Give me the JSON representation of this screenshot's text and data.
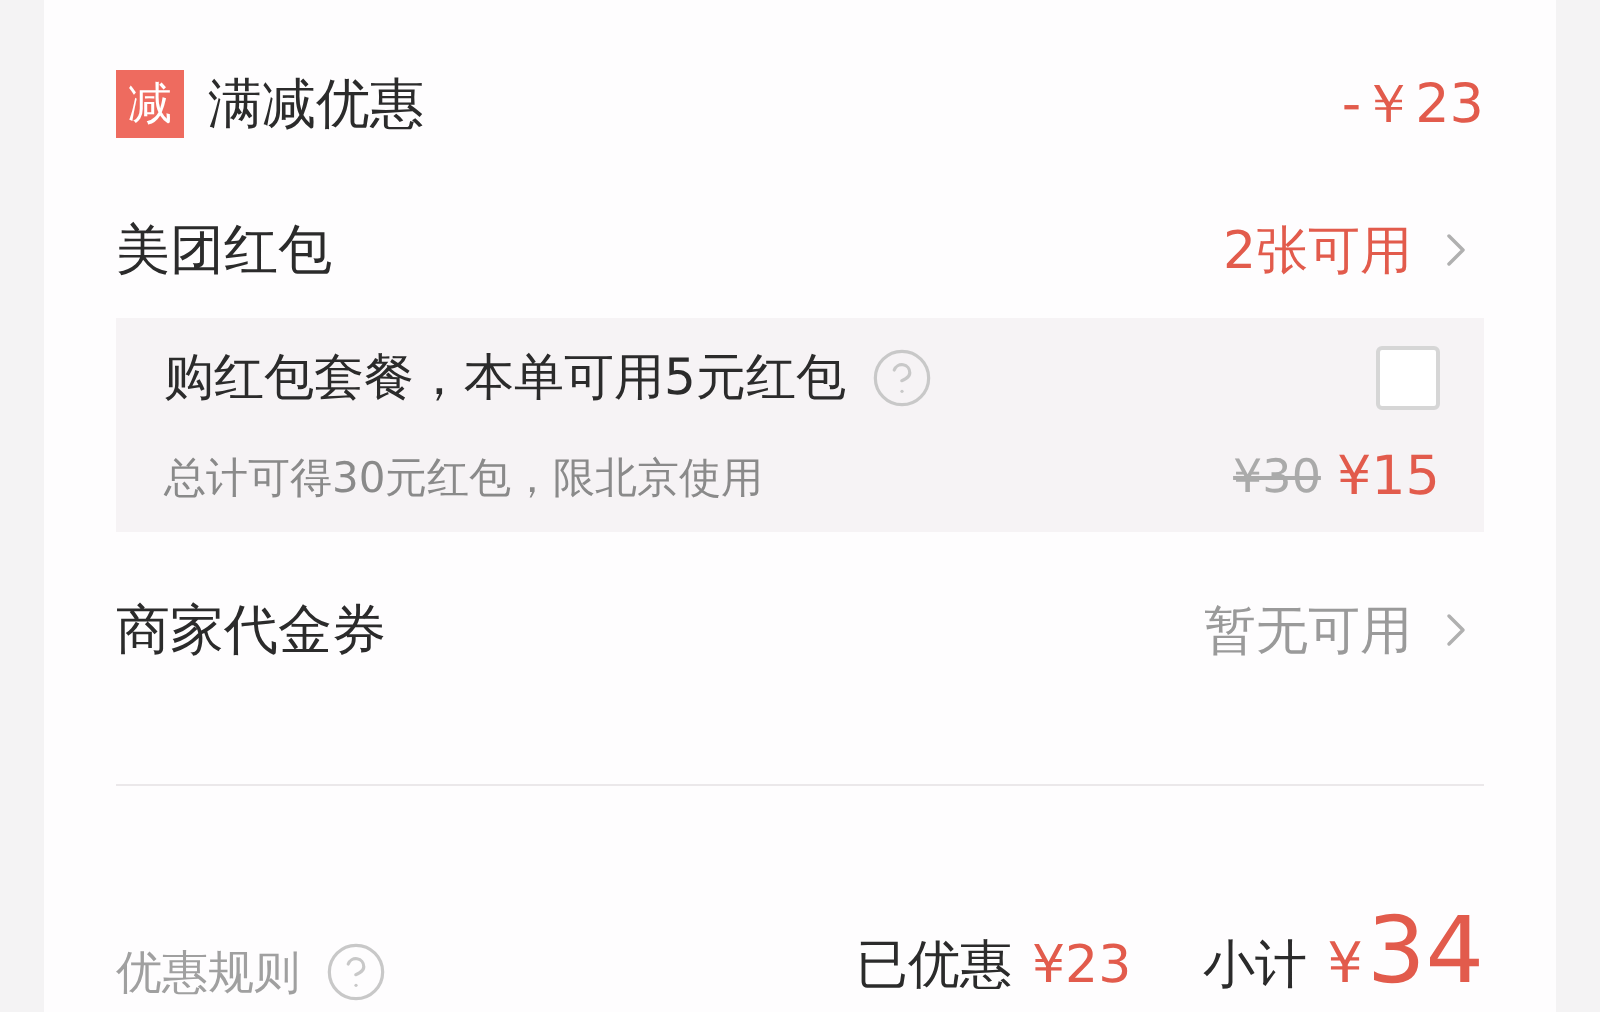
{
  "discount": {
    "badge": "减",
    "label": "满减优惠",
    "amount": "-￥23"
  },
  "rows": [
    {
      "label": "美团红包",
      "value": "2张可用",
      "highlight": true
    }
  ],
  "package": {
    "title": "购红包套餐，本单可用5元红包",
    "subtitle": "总计可得30元红包，限北京使用",
    "original_price": "¥30",
    "price": "¥15",
    "checked": false
  },
  "rows_after": [
    {
      "label": "商家代金券",
      "value": "暂无可用",
      "highlight": false
    }
  ],
  "footer": {
    "rules": "优惠规则",
    "saved_label": "已优惠",
    "saved": "¥23",
    "subtotal_label": "小计",
    "currency": "¥",
    "subtotal": "34"
  }
}
